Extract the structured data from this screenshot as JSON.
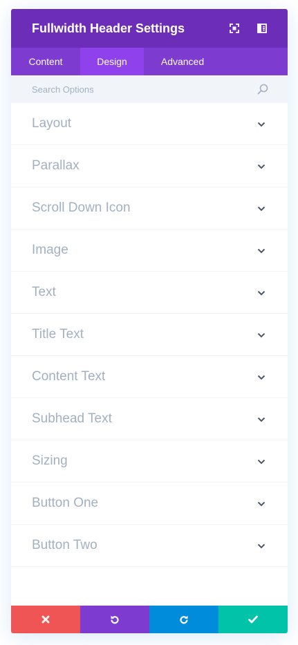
{
  "header": {
    "title": "Fullwidth Header Settings",
    "icons": [
      "expand-icon",
      "split-view-icon"
    ]
  },
  "tabs": [
    {
      "label": "Content",
      "active": false
    },
    {
      "label": "Design",
      "active": true
    },
    {
      "label": "Advanced",
      "active": false
    }
  ],
  "search": {
    "placeholder": "Search Options",
    "value": "",
    "icon": "search-icon"
  },
  "toggles": [
    {
      "label": "Layout"
    },
    {
      "label": "Parallax"
    },
    {
      "label": "Scroll Down Icon"
    },
    {
      "label": "Image"
    },
    {
      "label": "Text"
    },
    {
      "label": "Title Text"
    },
    {
      "label": "Content Text"
    },
    {
      "label": "Subhead Text"
    },
    {
      "label": "Sizing"
    },
    {
      "label": "Button One"
    },
    {
      "label": "Button Two"
    }
  ],
  "footer": {
    "buttons": [
      {
        "name": "cancel",
        "icon": "close-icon",
        "color": "#ef5555"
      },
      {
        "name": "undo",
        "icon": "undo-icon",
        "color": "#7d3bcf"
      },
      {
        "name": "redo",
        "icon": "redo-icon",
        "color": "#008bdb"
      },
      {
        "name": "save",
        "icon": "check-icon",
        "color": "#00c3aa"
      }
    ]
  },
  "colors": {
    "header_bg": "#6c2eb9",
    "tabs_bg": "#7e3bd0",
    "active_tab_bg": "#8f42ec",
    "search_bg": "#f1f5f9",
    "toggle_label": "#a2b0c1",
    "chevron": "#4c5866"
  }
}
